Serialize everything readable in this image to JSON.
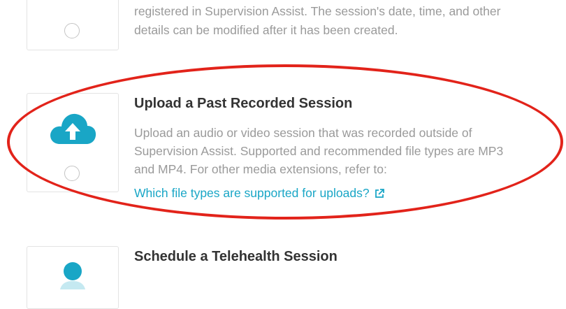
{
  "option_top": {
    "desc_line1": "registered in Supervision Assist. The session's date, time, and other",
    "desc_line2": "details can be modified after it has been created."
  },
  "option_upload": {
    "title": "Upload a Past Recorded Session",
    "desc_lines": [
      "Upload an audio or video session that was recorded outside of",
      "Supervision Assist. Supported and recommended file types are MP3",
      "and MP4. For other media extensions, refer to:"
    ],
    "link_text": "Which file types are supported for uploads?"
  },
  "option_telehealth": {
    "title": "Schedule a Telehealth Session"
  },
  "colors": {
    "accent": "#19a6c6",
    "annotation": "#e2231a",
    "title": "#333333",
    "body_text": "#9a9a9a"
  },
  "icons": {
    "upload": "cloud-upload-icon",
    "external_link": "external-link-icon",
    "telehealth": "telehealth-icon"
  }
}
